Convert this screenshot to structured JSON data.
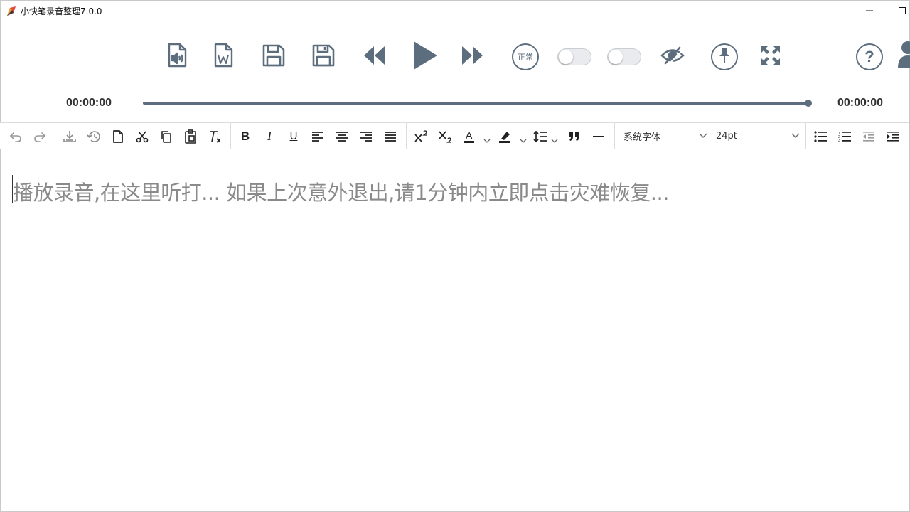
{
  "window": {
    "title": "小快笔录音整理7.0.0"
  },
  "toolbar": {
    "speed_label": "正常",
    "toggle1_on": false,
    "toggle2_on": false
  },
  "player": {
    "current_time": "00:00:00",
    "total_time": "00:00:00",
    "progress": 1.0
  },
  "editor_toolbar": {
    "font_family": "系统字体",
    "font_size": "24pt"
  },
  "editor": {
    "placeholder": "播放录音,在这里听打... 如果上次意外退出,请1分钟内立即点击灾难恢复..."
  },
  "colors": {
    "icon": "#5c6e7e",
    "text": "#333333",
    "placeholder": "#8a8a8a"
  }
}
